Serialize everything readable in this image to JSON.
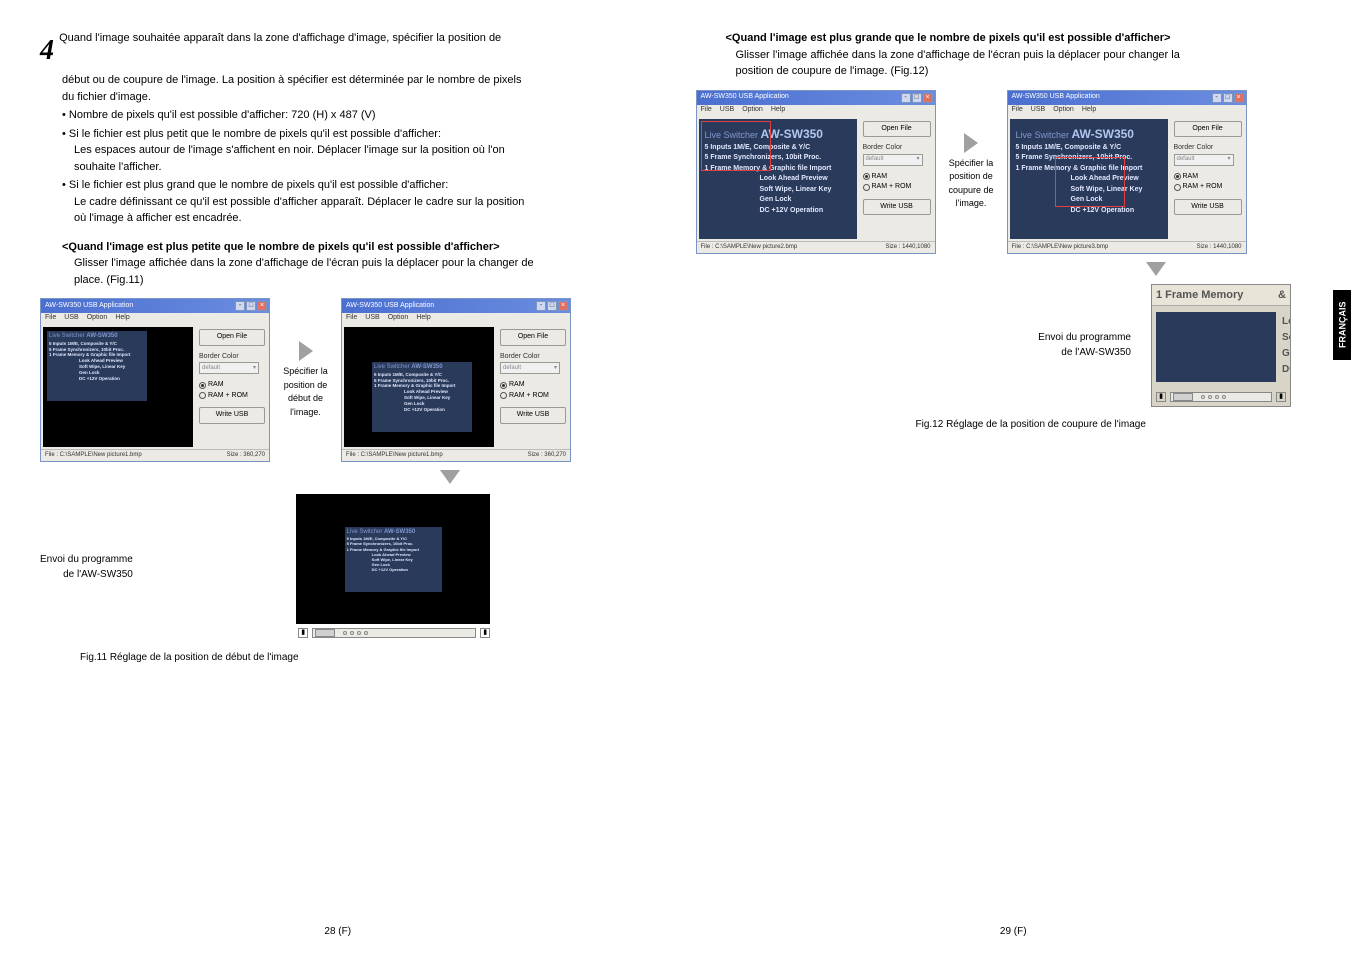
{
  "left": {
    "step_num": "4",
    "step_text_a": "Quand l'image souhaitée apparaît dans la zone d'affichage d'image, spécifier la position de",
    "step_text_b": "début ou de coupure de l'image. La position à spécifier est déterminée par le nombre de pixels",
    "step_text_c": "du fichier d'image.",
    "bullet1": "• Nombre de pixels qu'il est possible d'afficher: 720 (H) x 487 (V)",
    "bullet2_a": "• Si le fichier est plus petit que le nombre de pixels qu'il est possible d'afficher:",
    "bullet2_b": "Les espaces autour de l'image s'affichent en noir. Déplacer l'image sur la position où l'on",
    "bullet2_c": "souhaite l'afficher.",
    "bullet3_a": "• Si le fichier est plus grand que le nombre de pixels qu'il est possible d'afficher:",
    "bullet3_b": "Le cadre définissant ce qu'il est possible d'afficher apparaît. Déplacer le cadre sur la position",
    "bullet3_c": "où l'image à afficher est encadrée.",
    "case_title": "<Quand l'image est plus petite que le nombre de pixels qu'il est possible d'afficher>",
    "case_desc_a": "Glisser l'image affichée dans la zone d'affichage de l'écran puis la déplacer pour la changer de",
    "case_desc_b": "place. (Fig.11)",
    "arrow_label": "Spécifier la position de début de l'image.",
    "envoi_a": "Envoi du programme",
    "envoi_b": "de l'AW-SW350",
    "fig11": "Fig.11  Réglage de la position de début de l'image",
    "pagenum": "28 (F)"
  },
  "right": {
    "case_title": "<Quand l'image est plus grande que le nombre de pixels qu'il est possible d'afficher>",
    "case_desc_a": "Glisser l'image affichée dans la zone d'affichage de l'écran puis la déplacer pour changer la",
    "case_desc_b": "position de coupure de l'image. (Fig.12)",
    "arrow_label": "Spécifier la position de coupure de l'image.",
    "envoi_a": "Envoi du programme",
    "envoi_b": "de l'AW-SW350",
    "fig12": "Fig.12  Réglage de la position de coupure de l'image",
    "lang_tab": "FRANÇAIS",
    "pagenum": "29 (F)",
    "fm_title": "1 Frame Memory",
    "side_letters": [
      "Lo",
      "So",
      "Ge",
      "DC"
    ]
  },
  "app": {
    "title": "AW-SW350 USB Application",
    "menu": [
      "File",
      "USB",
      "Option",
      "Help"
    ],
    "open_file": "Open File",
    "border_color": "Border Color",
    "border_value": "default",
    "ram": "RAM",
    "ramrom": "RAM + ROM",
    "write_usb": "Write USB",
    "status_file_small": "File : C:\\SAMPLE\\New picture1.bmp",
    "status_size_small": "Size : 360,270",
    "status_file_large": "File : C:\\SAMPLE\\New picture2.bmp",
    "status_size_large": "Size : 1440,1080",
    "status_file_large2": "File : C:\\SAMPLE\\New picture3.bmp",
    "promo_lines": {
      "switcher": "Live Switcher",
      "model": "AW-SW350",
      "l1": "5 Inputs 1M/E, Composite & Y/C",
      "l2": "5 Frame Synchronizers, 10bit Proc.",
      "l3": "1 Frame Memory & Graphic file Import",
      "l4": "Look Ahead Preview",
      "l5": "Soft Wipe, Linear Key",
      "l6": "Gen Lock",
      "l7": "DC +12V Operation"
    }
  }
}
